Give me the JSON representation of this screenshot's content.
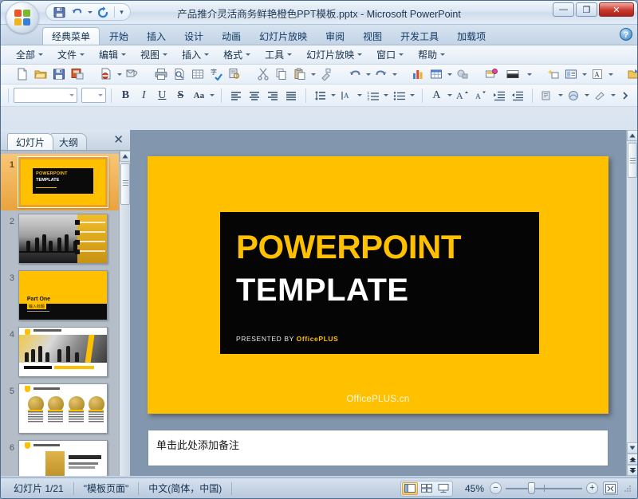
{
  "window": {
    "title": "产品推介灵活商务鲜艳橙色PPT模板.pptx - Microsoft PowerPoint",
    "minimize_label": "—",
    "maximize_label": "❐",
    "close_label": "✕"
  },
  "quick_access": {
    "save_label": "save-icon",
    "undo_label": "undo-icon",
    "redo_label": "redo-icon",
    "customize_label": "▾"
  },
  "ribbon": {
    "tabs": [
      {
        "label": "经典菜单",
        "active": true
      },
      {
        "label": "开始",
        "active": false
      },
      {
        "label": "插入",
        "active": false
      },
      {
        "label": "设计",
        "active": false
      },
      {
        "label": "动画",
        "active": false
      },
      {
        "label": "幻灯片放映",
        "active": false
      },
      {
        "label": "审阅",
        "active": false
      },
      {
        "label": "视图",
        "active": false
      },
      {
        "label": "开发工具",
        "active": false
      },
      {
        "label": "加载项",
        "active": false
      }
    ],
    "help_label": "?"
  },
  "classic_menu": {
    "items": [
      {
        "label": "全部"
      },
      {
        "label": "文件"
      },
      {
        "label": "编辑"
      },
      {
        "label": "视图"
      },
      {
        "label": "插入"
      },
      {
        "label": "格式"
      },
      {
        "label": "工具"
      },
      {
        "label": "幻灯片放映"
      },
      {
        "label": "窗口"
      },
      {
        "label": "帮助"
      }
    ]
  },
  "toolbar_row1": {
    "icons": [
      "new-document-icon",
      "open-folder-icon",
      "save-icon",
      "save-as-icon",
      "permission-icon",
      "email-attach-icon",
      "print-icon",
      "print-preview-icon",
      "table-icon",
      "spelling-check-icon",
      "research-icon",
      "cut-icon",
      "copy-icon",
      "paste-icon",
      "format-painter-icon",
      "undo-icon",
      "redo-icon",
      "insert-chart-icon",
      "insert-table-icon",
      "insert-shape-icon",
      "new-slide-icon",
      "slide-design-icon",
      "animation-icon",
      "slide-layout-icon",
      "font-color-icon",
      "expand-folder-icon",
      "zoom-search-icon"
    ]
  },
  "toolbar_row2": {
    "font_name": "",
    "font_size": "",
    "bold_label": "B",
    "italic_label": "I",
    "underline_label": "U",
    "shadow_label": "S",
    "case_label": "Aa",
    "align_icons": [
      "align-left-icon",
      "align-center-icon",
      "align-right-icon",
      "align-justify-icon"
    ],
    "paragraph_icons": [
      "line-spacing-icon",
      "text-direction-icon",
      "numbered-list-icon",
      "bulleted-list-icon"
    ],
    "font_icons": [
      "font-color-icon",
      "increase-font-icon",
      "decrease-font-icon",
      "increase-indent-icon",
      "decrease-indent-icon"
    ],
    "object_icons": [
      "insert-object-icon",
      "design-icon",
      "shape-fill-icon",
      "more-icon"
    ]
  },
  "left_panel": {
    "tabs": [
      {
        "label": "幻灯片",
        "active": true
      },
      {
        "label": "大纲",
        "active": false
      }
    ],
    "close_label": "✕",
    "slides": [
      {
        "number": "1",
        "selected": true,
        "kind": "title",
        "line1": "POWERPOINT",
        "line2": "TEMPLATE"
      },
      {
        "number": "2",
        "selected": false,
        "kind": "photo-list",
        "line1": "",
        "line2": ""
      },
      {
        "number": "3",
        "selected": false,
        "kind": "section",
        "line1": "Part One",
        "line2": "输入标题"
      },
      {
        "number": "4",
        "selected": false,
        "kind": "banner",
        "line1": "",
        "line2": ""
      },
      {
        "number": "5",
        "selected": false,
        "kind": "four-coins",
        "line1": "",
        "line2": ""
      },
      {
        "number": "6",
        "selected": false,
        "kind": "card-text",
        "line1": "",
        "line2": ""
      }
    ]
  },
  "slide": {
    "background_color": "#FFC000",
    "panel_color": "#050505",
    "title_line1": "POWERPOINT",
    "title_line1_color": "#FFC000",
    "title_line2": "TEMPLATE",
    "title_line2_color": "#FFFFFF",
    "presented_by_prefix": "PRESENTED BY ",
    "presented_by_brand": "OfficePLUS",
    "footer": "OfficePLUS.cn"
  },
  "notes": {
    "placeholder": "单击此处添加备注"
  },
  "status_bar": {
    "slide_counter": "幻灯片 1/21",
    "theme_name": "\"模板页面\"",
    "language": "中文(简体，中国)",
    "views": [
      {
        "name": "normal-view-icon",
        "active": true
      },
      {
        "name": "slide-sorter-icon",
        "active": false
      },
      {
        "name": "slide-show-icon",
        "active": false
      }
    ],
    "zoom_percent": "45%",
    "zoom_out_label": "−",
    "zoom_in_label": "+",
    "fit_label": "fit-to-window-icon"
  }
}
